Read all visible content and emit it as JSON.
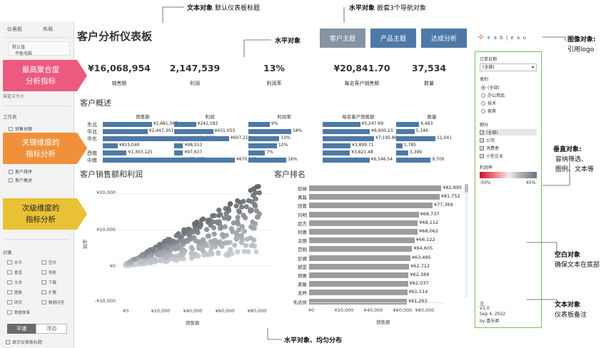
{
  "tool_pane": {
    "tabs": [
      "仪表板",
      "布局"
    ],
    "device_items": [
      "默认值",
      "平板电脑"
    ],
    "size_label": "大小",
    "custom_label": "自定义大小",
    "sheets_heading": "工作表",
    "sheets": [
      "销售总额",
      "",
      "",
      "",
      "",
      "客户排序",
      "客户概述"
    ],
    "objects_heading": "对象",
    "objects": [
      "水平",
      "空白",
      "垂直",
      "导航",
      "文本",
      "下载",
      "图像",
      "扩展",
      "网页",
      "数据问答",
      "数据故事"
    ],
    "tile_label": "平铺",
    "float_label": "浮动",
    "show_title_label": "显示仪表板标题"
  },
  "dashboard": {
    "title": "客户分析仪表板",
    "nav_buttons": [
      {
        "label": "客户主题",
        "color": "#8593a3"
      },
      {
        "label": "产品主题",
        "color": "#4e79a7"
      },
      {
        "label": "达成分析",
        "color": "#4e79a7"
      }
    ],
    "logo_text": "+ a b | e a u",
    "kpis": [
      {
        "value": "¥16,068,954",
        "label": "销售额"
      },
      {
        "value": "2,147,539",
        "label": "利润"
      },
      {
        "value": "13%",
        "label": "利润率"
      },
      {
        "value": "¥20,841.70",
        "label": "每名客户销售额"
      },
      {
        "value": "37,534",
        "label": "数量"
      }
    ],
    "overview": {
      "title": "客户概述",
      "columns": [
        "销售额",
        "利润",
        "利润率",
        "每名客户销售额",
        "数量"
      ],
      "regions": [
        "东北",
        "华北",
        "华东",
        "",
        "西南",
        "中南"
      ],
      "sales": [
        "¥2,681,567",
        "¥2,447,301",
        "¥4,684,506",
        "¥815,040",
        "¥1,303,125",
        "¥4,137,415"
      ],
      "sales_values": [
        2681567,
        2447301,
        4684506,
        815040,
        1303125,
        4137415
      ],
      "profit": [
        "¥242,192",
        "¥431,053",
        "¥607,219",
        "¥98,553",
        "¥97,637",
        "¥670,885"
      ],
      "profit_values": [
        242192,
        431053,
        607219,
        98553,
        97637,
        670885
      ],
      "margin": [
        "9%",
        "18%",
        "13%",
        "12%",
        "7%",
        "16%"
      ],
      "margin_values": [
        9,
        18,
        13,
        12,
        7,
        16
      ],
      "per_customer": [
        "¥5,247.69",
        "¥6,600.23",
        "¥7,195.86",
        "¥3,899.71",
        "¥3,821.48",
        "¥6,546.54"
      ],
      "per_customer_values": [
        5247.69,
        6600.23,
        7195.86,
        3899.71,
        3821.48,
        6546.54
      ],
      "qty": [
        "6,463",
        "5,146",
        "11,041",
        "1,785",
        "3,399",
        "9,700"
      ],
      "qty_values": [
        6463,
        5146,
        11041,
        1785,
        3399,
        9700
      ]
    },
    "scatter": {
      "title": "客户销售额和利润",
      "y_label": "利润",
      "x_label": "销售额",
      "y_ticks": [
        "¥20,000",
        "¥10,000",
        "¥0",
        "-¥10,000"
      ],
      "x_ticks": [
        "¥0",
        "¥20,000",
        "¥40,000",
        "¥60,000",
        "¥80,000"
      ]
    },
    "ranking": {
      "title": "客户排名",
      "names": [
        "徐婵",
        "黄磊",
        "田葛",
        "刘明",
        "武杰",
        "何惠",
        "涂丽",
        "范刚",
        "彭娜",
        "郝雯",
        "郑惠",
        "姜敏",
        "龙婷",
        "毛达侯"
      ],
      "labels": [
        "¥82,895",
        "¥81,752",
        "¥77,369",
        "¥68,737",
        "¥68,112",
        "¥68,062",
        "¥66,122",
        "¥64,605",
        "¥63,495",
        "¥62,712",
        "¥62,389",
        "¥62,037",
        "¥61,514",
        "¥61,263"
      ],
      "values": [
        82895,
        81752,
        77369,
        68737,
        68112,
        68062,
        66122,
        64605,
        63495,
        62712,
        62389,
        62037,
        61514,
        61263
      ],
      "x_ticks": [
        "¥0",
        "¥20,000",
        "¥40,000",
        "¥60,000",
        "¥80,000"
      ],
      "x_label": "销售额"
    }
  },
  "filters": {
    "order_date_label": "订单日期",
    "order_date_value": "(全部)",
    "category_label": "类别",
    "category_options": [
      "(全部)",
      "办公用品",
      "技术",
      "家具"
    ],
    "segment_label": "细分",
    "segment_options": [
      "(全部)",
      "公司",
      "消费者",
      "小型企业"
    ],
    "margin_label": "利润率",
    "margin_min": "-50%",
    "margin_max": "45%",
    "note_lines": [
      "注:",
      "V1.0",
      "Sep 4, 2022",
      "by 喜乐君"
    ]
  },
  "annotations": {
    "text_object_top": "文本对象",
    "text_object_top_desc": "默认仪表板标题",
    "horizontal_nav": "水平对象",
    "horizontal_nav_desc": "嵌套3个导航对象",
    "horizontal_kpi": "水平对象",
    "image_object": "图像对象:",
    "image_object_desc": "引用logo",
    "callout_kpi": [
      "最高聚合度",
      "分析指标"
    ],
    "callout_key": [
      "关键维度的",
      "指标分析"
    ],
    "callout_sub": [
      "次级维度的",
      "指标分析"
    ],
    "vertical_object": "垂直对象:",
    "vertical_object_desc": [
      "容纳筛选、",
      "图例、文本等"
    ],
    "blank_object": "空白对象",
    "blank_object_desc": "确保文本在底部",
    "text_object_note": "文本对象",
    "text_object_note_desc": "仪表板备注",
    "horizontal_bottom": "水平对象、均匀分布"
  }
}
